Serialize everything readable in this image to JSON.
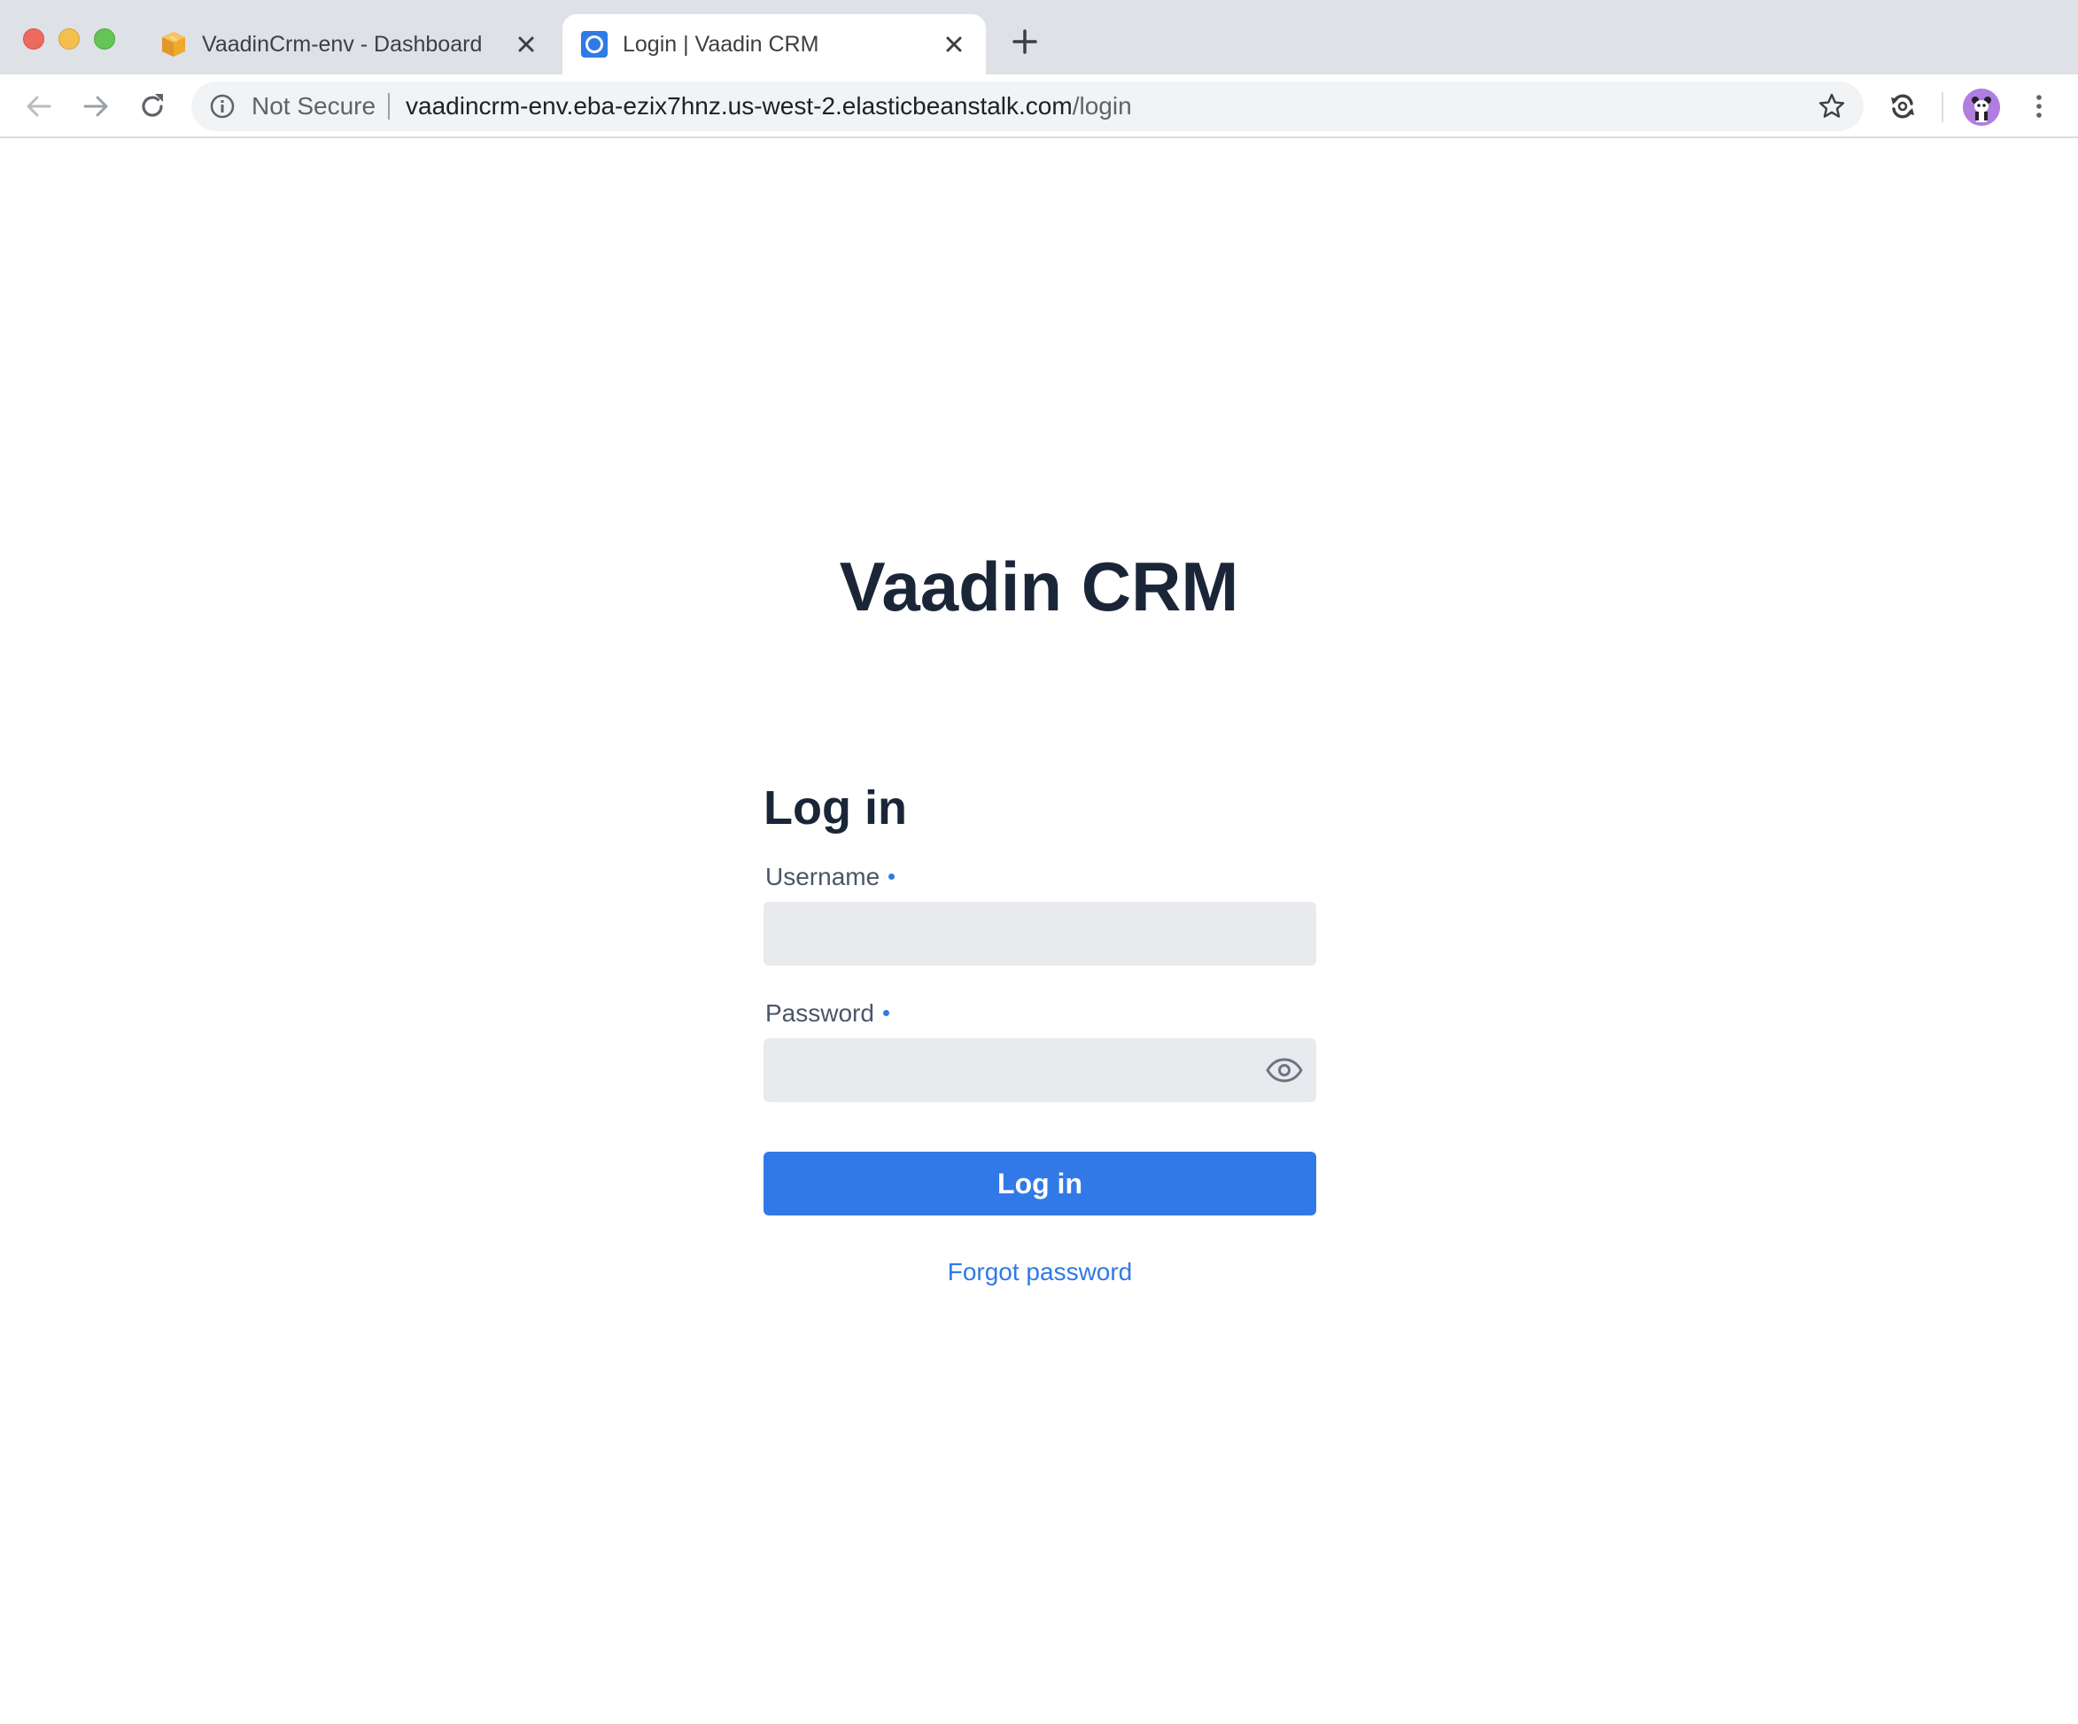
{
  "browser": {
    "tabs": [
      {
        "title": "VaadinCrm-env - Dashboard",
        "icon": "aws-package-icon",
        "active": false
      },
      {
        "title": "Login | Vaadin CRM",
        "icon": "vaadin-logo-icon",
        "active": true
      }
    ],
    "address_bar": {
      "security_label": "Not Secure",
      "url_host": "vaadincrm-env.eba-ezix7hnz.us-west-2.elasticbeanstalk.com",
      "url_path": "/login"
    }
  },
  "page": {
    "app_title": "Vaadin CRM",
    "login_form": {
      "title": "Log in",
      "username_label": "Username",
      "username_value": "",
      "password_label": "Password",
      "password_value": "",
      "submit_label": "Log in",
      "forgot_label": "Forgot password"
    }
  },
  "colors": {
    "accent": "#3279e8",
    "link": "#2f7ae5",
    "heading": "#1a2638",
    "input_bg": "#e8eaee"
  }
}
